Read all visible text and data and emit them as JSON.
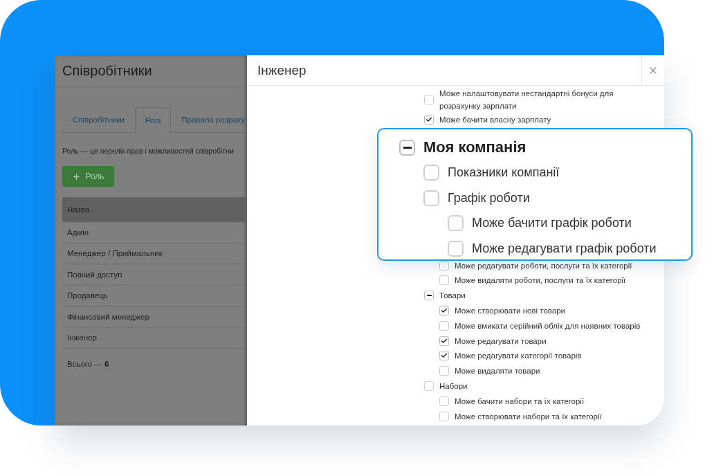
{
  "background_page": {
    "title": "Співробітники",
    "tabs": [
      {
        "label": "Співробітники",
        "selected": false
      },
      {
        "label": "Ролі",
        "selected": true
      },
      {
        "label": "Правила розраху",
        "selected": false
      }
    ],
    "description": "Роль — це перелік прав і можливостей співробітни",
    "add_button": {
      "label": "Роль"
    },
    "table": {
      "columns": [
        "Назва"
      ],
      "rows": [
        "Адмін",
        "Менеджер / Приймальник",
        "Повний доступ",
        "Продавець",
        "Фінансовий менеджер",
        "Інженер"
      ]
    },
    "total": "Всього — **6**"
  },
  "dialog": {
    "title": "Інженер",
    "permissions_top": [
      {
        "label": "Може налаштовувати нестандартні бонуси для розрахунку зарплати",
        "checked": false
      },
      {
        "label": "Може бачити власну зарплату",
        "checked": true
      }
    ],
    "permissions_bottom": [
      {
        "children": [
          {
            "label": "Може редагувати роботи, послуги та їх категорії",
            "checked": false
          },
          {
            "label": "Може видаляти роботи, послуги та їх категорії",
            "checked": false
          }
        ]
      },
      {
        "label": "Товари",
        "indeterminate": true,
        "children": [
          {
            "label": "Може створювати нові товари",
            "checked": true
          },
          {
            "label": "Може вмикати серійний облік для наявних товарів",
            "checked": false
          },
          {
            "label": "Може редагувати товари",
            "checked": true
          },
          {
            "label": "Може редагувати категорії товарів",
            "checked": true
          },
          {
            "label": "Може видаляти товари",
            "checked": false
          }
        ]
      },
      {
        "label": "Набори",
        "checked": false,
        "children": [
          {
            "label": "Може бачити набори та їх категорії",
            "checked": false
          },
          {
            "label": "Може створювати набори та їх категорії",
            "checked": false
          }
        ]
      }
    ]
  },
  "callout": {
    "items": [
      {
        "label": "Моя компанія",
        "indeterminate": true,
        "children": [
          {
            "label": "Показники компанії",
            "checked": false
          },
          {
            "label": "Графік роботи",
            "checked": false,
            "children": [
              {
                "label": "Може бачити графік роботи",
                "checked": false
              },
              {
                "label": "Може редагувати графік роботи",
                "checked": false
              }
            ]
          }
        ]
      }
    ]
  }
}
